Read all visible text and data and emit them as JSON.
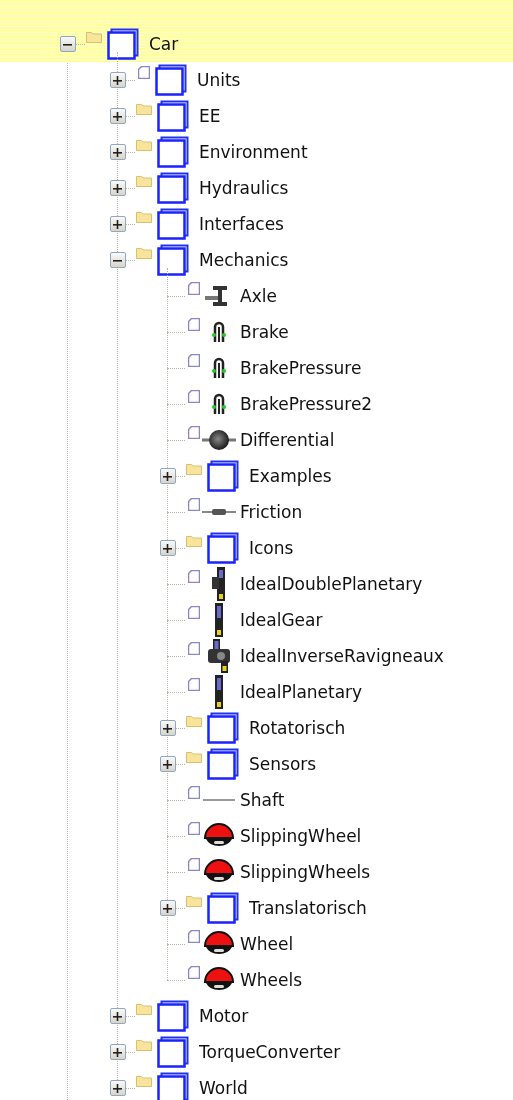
{
  "tree": [
    {
      "label": "Car",
      "kind": "package",
      "folder_badge": true,
      "expanded": true,
      "selected": true,
      "children": [
        {
          "label": "Units",
          "kind": "package",
          "folder_badge": false,
          "expanded": false,
          "selected": false
        },
        {
          "label": "EE",
          "kind": "package",
          "folder_badge": true,
          "expanded": false,
          "selected": false
        },
        {
          "label": "Environment",
          "kind": "package",
          "folder_badge": true,
          "expanded": false,
          "selected": false
        },
        {
          "label": "Hydraulics",
          "kind": "package",
          "folder_badge": true,
          "expanded": false,
          "selected": false
        },
        {
          "label": "Interfaces",
          "kind": "package",
          "folder_badge": true,
          "expanded": false,
          "selected": false
        },
        {
          "label": "Mechanics",
          "kind": "package",
          "folder_badge": true,
          "expanded": true,
          "selected": false,
          "children": [
            {
              "label": "Axle",
              "kind": "axle",
              "folder_badge": false,
              "selected": false
            },
            {
              "label": "Brake",
              "kind": "brake",
              "folder_badge": false,
              "selected": false
            },
            {
              "label": "BrakePressure",
              "kind": "brake",
              "folder_badge": false,
              "selected": false
            },
            {
              "label": "BrakePressure2",
              "kind": "brake",
              "folder_badge": false,
              "selected": false
            },
            {
              "label": "Differential",
              "kind": "ball",
              "folder_badge": false,
              "selected": false
            },
            {
              "label": "Examples",
              "kind": "package",
              "folder_badge": true,
              "expanded": false,
              "selected": false
            },
            {
              "label": "Friction",
              "kind": "friction",
              "folder_badge": false,
              "selected": false
            },
            {
              "label": "Icons",
              "kind": "package",
              "folder_badge": true,
              "expanded": false,
              "selected": false
            },
            {
              "label": "IdealDoublePlanetary",
              "kind": "double-planetary",
              "folder_badge": false,
              "selected": false
            },
            {
              "label": "IdealGear",
              "kind": "planetary",
              "folder_badge": false,
              "selected": false
            },
            {
              "label": "IdealInverseRavigneaux",
              "kind": "ravigneaux",
              "folder_badge": false,
              "selected": false
            },
            {
              "label": "IdealPlanetary",
              "kind": "planetary",
              "folder_badge": false,
              "selected": false
            },
            {
              "label": "Rotatorisch",
              "kind": "package",
              "folder_badge": true,
              "expanded": false,
              "selected": false
            },
            {
              "label": "Sensors",
              "kind": "package",
              "folder_badge": true,
              "expanded": false,
              "selected": false
            },
            {
              "label": "Shaft",
              "kind": "shaft",
              "folder_badge": false,
              "selected": false
            },
            {
              "label": "SlippingWheel",
              "kind": "wheel",
              "folder_badge": false,
              "selected": false
            },
            {
              "label": "SlippingWheels",
              "kind": "wheel",
              "folder_badge": false,
              "selected": false
            },
            {
              "label": "Translatorisch",
              "kind": "package",
              "folder_badge": true,
              "expanded": false,
              "selected": false
            },
            {
              "label": "Wheel",
              "kind": "wheel",
              "folder_badge": false,
              "selected": false
            },
            {
              "label": "Wheels",
              "kind": "wheel",
              "folder_badge": false,
              "selected": false
            }
          ]
        },
        {
          "label": "Motor",
          "kind": "package",
          "folder_badge": true,
          "expanded": false,
          "selected": false
        },
        {
          "label": "TorqueConverter",
          "kind": "package",
          "folder_badge": true,
          "expanded": false,
          "selected": false
        },
        {
          "label": "World",
          "kind": "package",
          "folder_badge": true,
          "expanded": false,
          "selected": false
        }
      ]
    }
  ]
}
